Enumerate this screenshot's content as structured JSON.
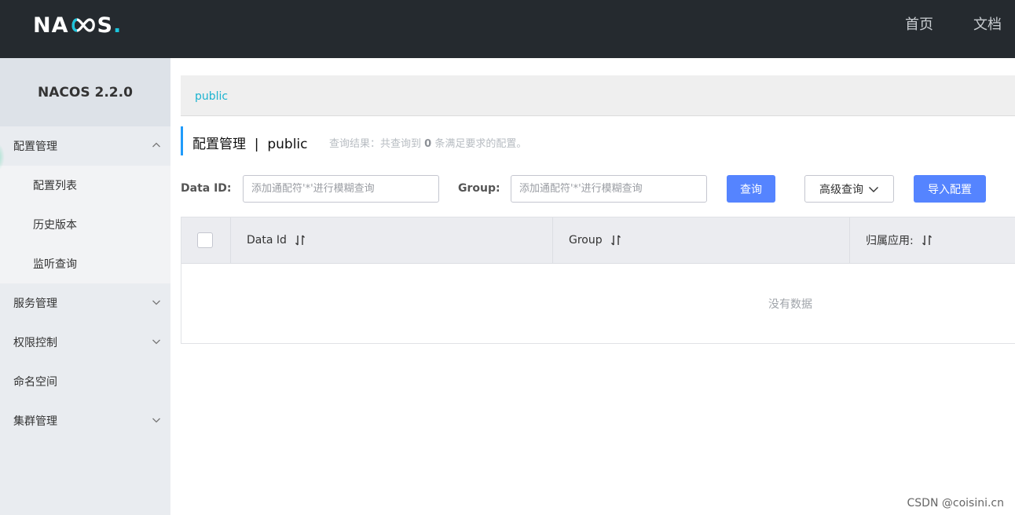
{
  "header": {
    "logo_text_1": "NA",
    "logo_text_2": "S",
    "logo_dot": ".",
    "nav": [
      "首页",
      "文档"
    ]
  },
  "sidebar": {
    "version": "NACOS 2.2.0",
    "items": [
      {
        "label": "配置管理",
        "icon": "chevron-up-icon"
      },
      {
        "label": "配置列表"
      },
      {
        "label": "历史版本"
      },
      {
        "label": "监听查询"
      },
      {
        "label": "服务管理",
        "icon": "chevron-down-icon"
      },
      {
        "label": "权限控制",
        "icon": "chevron-down-icon"
      },
      {
        "label": "命名空间"
      },
      {
        "label": "集群管理",
        "icon": "chevron-down-icon"
      }
    ]
  },
  "main": {
    "namespace_tab": "public",
    "title": "配置管理  |  public",
    "result_prefix": "查询结果：共查询到",
    "result_count": "0",
    "result_suffix": "条满足要求的配置。",
    "search": {
      "data_id_label": "Data ID:",
      "data_id_placeholder": "添加通配符'*'进行模糊查询",
      "group_label": "Group:",
      "group_placeholder": "添加通配符'*'进行模糊查询",
      "query_button": "查询",
      "advanced_button": "高级查询",
      "import_button": "导入配置"
    },
    "table": {
      "columns": [
        "Data Id",
        "Group",
        "归属应用:"
      ],
      "empty_text": "没有数据"
    }
  },
  "watermark": "CSDN @coisini.cn",
  "colors": {
    "topbar": "#252a2f",
    "accent": "#1bc4dc",
    "primary_button": "#5584ff"
  }
}
